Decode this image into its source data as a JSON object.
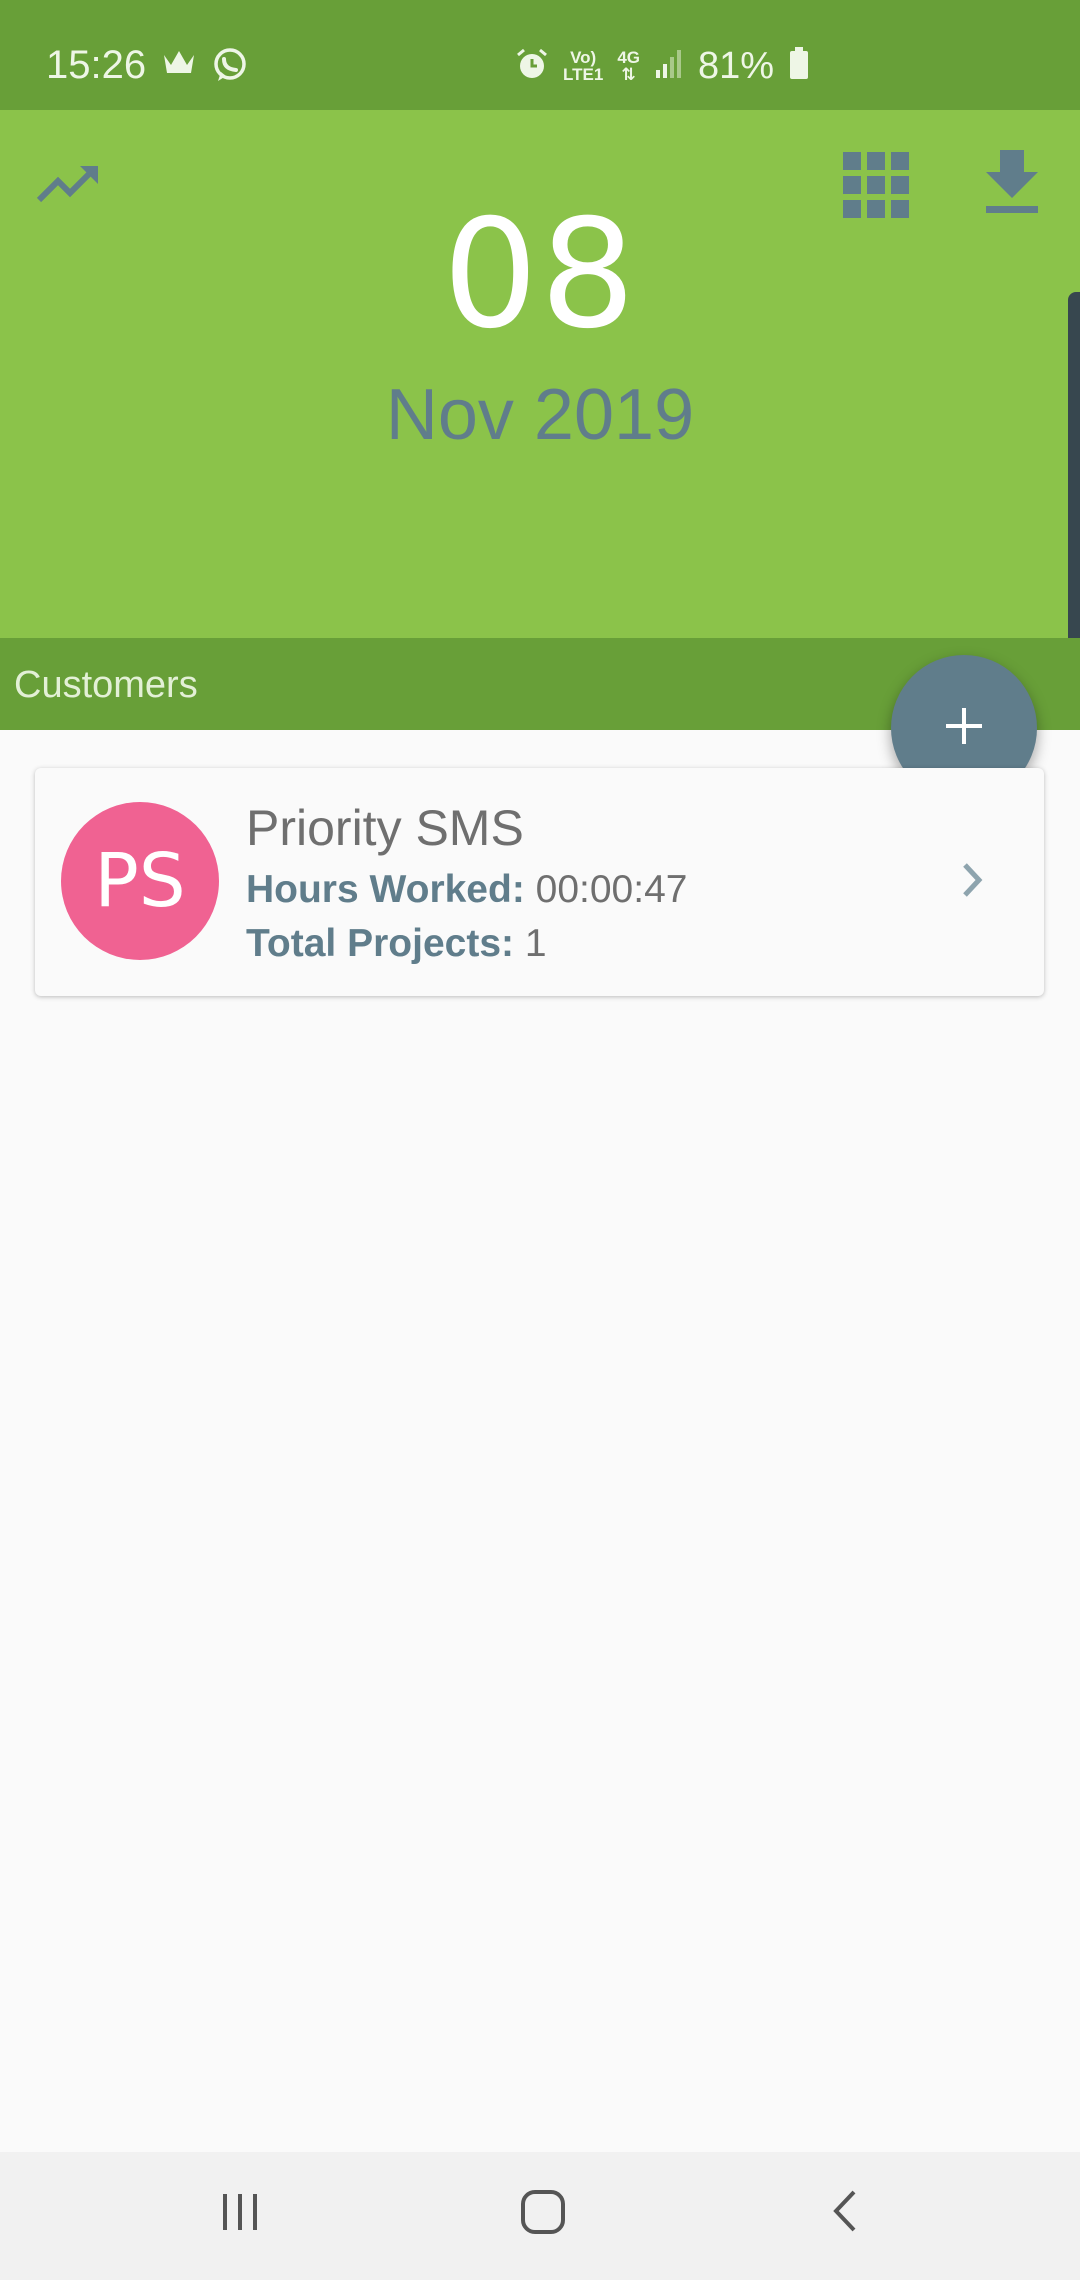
{
  "status_bar": {
    "time": "15:26",
    "net_top": "Vo)",
    "net_bottom": "LTE1",
    "net_type": "4G",
    "battery": "81%",
    "icons": [
      "crown-icon",
      "whatsapp-icon",
      "alarm-icon",
      "signal-icon",
      "battery-icon"
    ]
  },
  "header": {
    "icons": [
      "trending-up-icon",
      "grid-icon",
      "download-icon"
    ],
    "day": "08",
    "month_year": "Nov 2019"
  },
  "section": {
    "title": "Customers"
  },
  "fab": {
    "icon": "plus-icon"
  },
  "customers": [
    {
      "initials": "PS",
      "name": "Priority SMS",
      "hours_label": "Hours Worked:",
      "hours_value": "00:00:47",
      "projects_label": "Total Projects:",
      "projects_value": "1"
    }
  ],
  "colors": {
    "status_bar": "#689f38",
    "header": "#8bc34a",
    "accent": "#607d8b",
    "avatar": "#f06292"
  },
  "nav_bar": {
    "icons": [
      "recent-apps-icon",
      "home-icon",
      "back-icon"
    ]
  }
}
